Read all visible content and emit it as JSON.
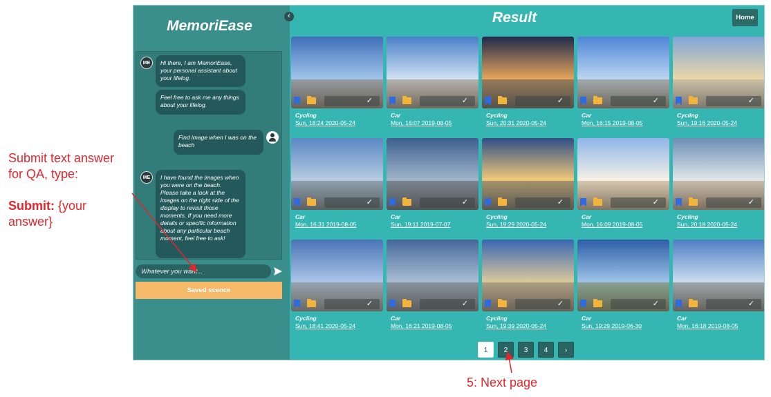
{
  "annotations": {
    "left_line1": "Submit text answer",
    "left_line2": "for QA, type:",
    "submit_label": "Submit:",
    "submit_rest": " {your",
    "answer_line": "answer}",
    "bottom": "5: Next page",
    "color": "#e4252b"
  },
  "sidebar": {
    "title": "MemoriEase",
    "collapse_icon": "chevron-left-icon",
    "bot_avatar_text": "ME",
    "messages": [
      {
        "from": "bot",
        "text": "Hi there, I am MemoriEase, your personal assistant about your lifelog."
      },
      {
        "from": "bot",
        "text": "Feel free to ask me any things about your lifelog."
      },
      {
        "from": "user",
        "text": "Find image when I was on the beach"
      },
      {
        "from": "bot",
        "text": "I have found the images when you were on the beach. Please take a look at the images on the right side of the display to revisit those moments. If you need more details or specific information about any particular beach moment, feel free to ask!"
      }
    ],
    "input_placeholder": "Whatever you want...",
    "send_icon": "send-icon",
    "saved_button": "Saved scence"
  },
  "header": {
    "title": "Result",
    "home_button": "Home"
  },
  "results": [
    {
      "label": "Cycling",
      "date": "Sun, 18:24 2020-05-24"
    },
    {
      "label": "Car",
      "date": "Mon, 16:07 2019-08-05"
    },
    {
      "label": "Cycling",
      "date": "Sun, 20:31 2020-05-24"
    },
    {
      "label": "Car",
      "date": "Mon, 16:15 2019-08-05"
    },
    {
      "label": "Cycling",
      "date": "Sun, 19:16 2020-05-24"
    },
    {
      "label": "Car",
      "date": "Mon, 16:31 2019-08-05"
    },
    {
      "label": "Car",
      "date": "Sun, 19:11 2019-07-07"
    },
    {
      "label": "Cycling",
      "date": "Sun, 19:29 2020-05-24"
    },
    {
      "label": "Car",
      "date": "Mon, 16:09 2019-08-05"
    },
    {
      "label": "Cycling",
      "date": "Sun, 20:18 2020-05-24"
    },
    {
      "label": "Cycling",
      "date": "Sun, 18:41 2020-05-24"
    },
    {
      "label": "Car",
      "date": "Mon, 16:21 2019-08-05"
    },
    {
      "label": "Cycling",
      "date": "Sun, 19:39 2020-05-24"
    },
    {
      "label": "Car",
      "date": "Sun, 19:29 2019-06-30"
    },
    {
      "label": "Car",
      "date": "Mon, 16:18 2019-08-05"
    }
  ],
  "pagination": {
    "pages": [
      "1",
      "2",
      "3",
      "4"
    ],
    "current": "1",
    "next_icon": "chevron-right-icon"
  }
}
